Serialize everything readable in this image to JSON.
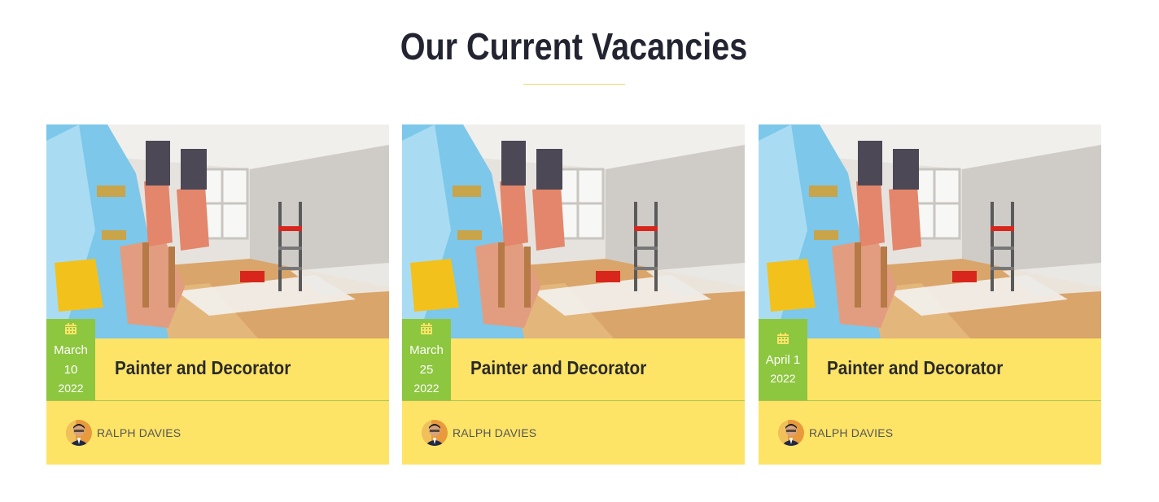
{
  "section": {
    "title": "Our Current Vacancies"
  },
  "vacancies": [
    {
      "month": "March",
      "day": "10",
      "year": "2022",
      "title": "Painter and Decorator",
      "author": "RALPH DAVIES"
    },
    {
      "month": "March",
      "day": "25",
      "year": "2022",
      "title": "Painter and Decorator",
      "author": "RALPH DAVIES"
    },
    {
      "month": "April 1",
      "day": "",
      "year": "2022",
      "title": "Painter and Decorator",
      "author": "RALPH DAVIES"
    }
  ],
  "icons": {
    "date": "calendar-icon",
    "author": "avatar"
  },
  "colors": {
    "heading": "#232431",
    "card_background": "#fee466",
    "date_badge": "#8dc63f",
    "divider": "#f1d36a"
  }
}
